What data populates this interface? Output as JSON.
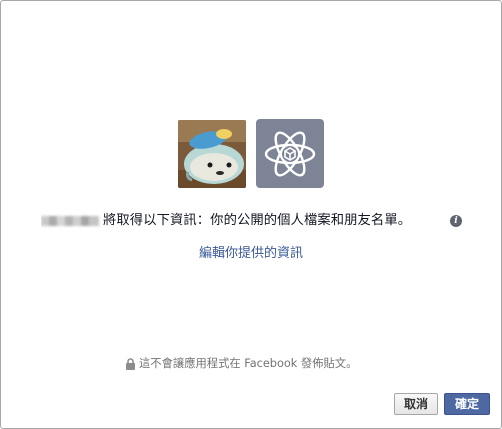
{
  "dialog": {
    "permission_text": "將取得以下資訊：你的公開的個人檔案和朋友名單。",
    "info_icon_glyph": "i",
    "edit_link": "編輯你提供的資訊",
    "privacy_note": "這不會讓應用程式在 Facebook 發佈貼文。",
    "buttons": {
      "cancel": "取消",
      "confirm": "確定"
    }
  },
  "icons": {
    "user_avatar": "plush-toy-photo",
    "app_icon": "atom-cube-icon",
    "info": "info-icon",
    "lock": "lock-icon"
  },
  "colors": {
    "link": "#3b5998",
    "primary_button": "#4e69a2",
    "app_icon_bg": "#7d8496",
    "muted_text": "#737373"
  }
}
